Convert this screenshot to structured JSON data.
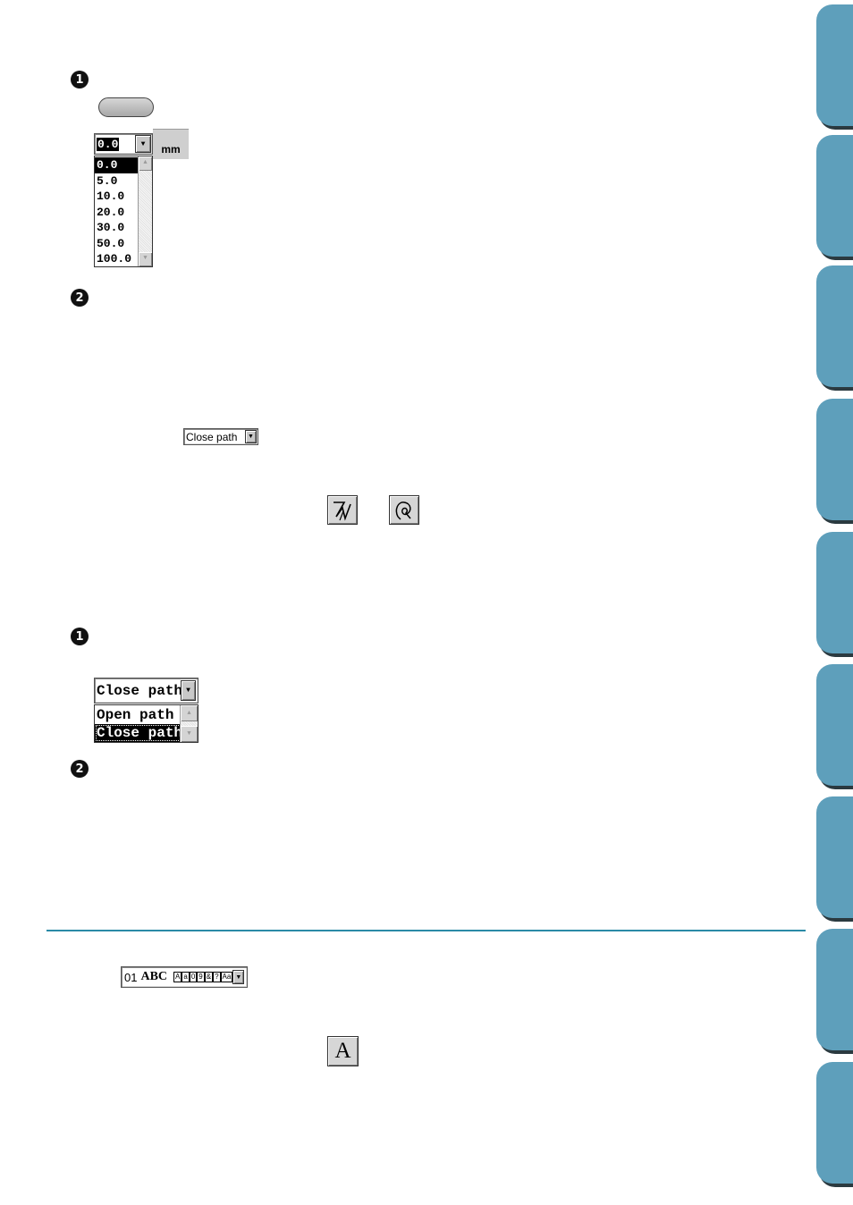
{
  "steps": {
    "section1_step1": "1",
    "section1_step2": "2",
    "section2_step1": "1",
    "section2_step2": "2"
  },
  "offset_dropdown": {
    "current_value": "0.0",
    "unit": "mm",
    "options": [
      "0.0",
      "5.0",
      "10.0",
      "20.0",
      "30.0",
      "50.0",
      "100.0"
    ],
    "selected_index": 0
  },
  "path_selector_small": {
    "current_value": "Close path"
  },
  "path_dropdown_large": {
    "current_value": "Close path",
    "options": [
      "Open path",
      "Close path"
    ],
    "selected_index": 1
  },
  "font_selector": {
    "number": "01",
    "sample": "ABC",
    "badges": [
      "A",
      "a",
      "0",
      "9",
      "&",
      "?",
      "Aa"
    ]
  },
  "text_tool_button": {
    "glyph": "A"
  },
  "colors": {
    "tab": "#5e9fbb",
    "divider": "#2a8aa6"
  }
}
